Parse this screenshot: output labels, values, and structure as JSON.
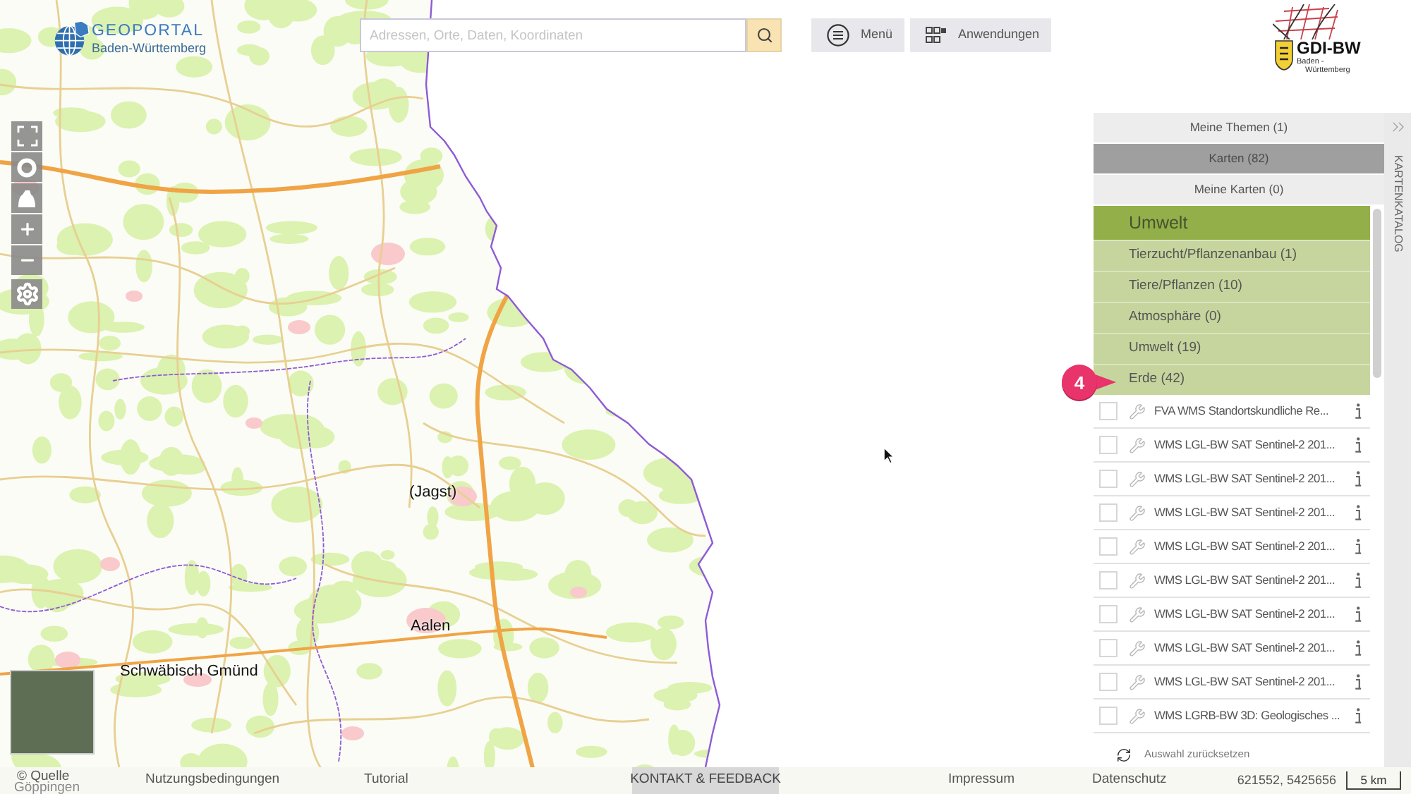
{
  "header": {
    "logo": {
      "title": "GEOPORTAL",
      "subtitle": "Baden-Württemberg"
    },
    "search": {
      "placeholder": "Adressen, Orte, Daten, Koordinaten"
    },
    "buttons": [
      {
        "kind": "menu",
        "label": "Menü"
      },
      {
        "kind": "apps",
        "label": "Anwendungen"
      }
    ],
    "partner_logo": {
      "title": "GDI-BW",
      "lines": [
        "Baden -",
        "Württemberg"
      ]
    }
  },
  "map": {
    "tools": [
      {
        "kind": "fullscreen"
      },
      {
        "kind": "locate"
      },
      {
        "kind": "home"
      },
      {
        "kind": "zoom_in"
      },
      {
        "kind": "zoom_out"
      },
      {
        "kind": "settings"
      }
    ],
    "labels": [
      "(Jagst)",
      "Aalen",
      "Schwäbisch Gmünd",
      "Göppingen"
    ]
  },
  "catalog": {
    "side_label": "KARTENKATALOG",
    "tabs": [
      {
        "label": "Meine Themen (1)",
        "selected": false
      },
      {
        "label": "Karten (82)",
        "selected": true
      },
      {
        "label": "Meine Karten (0)",
        "selected": false
      }
    ],
    "category": "Umwelt",
    "subcategories": [
      "Tierzucht/Pflanzenanbau (1)",
      "Tiere/Pflanzen (10)",
      "Atmosphäre (0)",
      "Umwelt (19)",
      "Erde (42)"
    ],
    "layers": [
      {
        "name": "FVA WMS Standortskundliche Re...",
        "checked": false
      },
      {
        "name": "WMS LGL-BW SAT Sentinel-2 201...",
        "checked": false
      },
      {
        "name": "WMS LGL-BW SAT Sentinel-2 201...",
        "checked": false
      },
      {
        "name": "WMS LGL-BW SAT Sentinel-2 201...",
        "checked": false
      },
      {
        "name": "WMS LGL-BW SAT Sentinel-2 201...",
        "checked": false
      },
      {
        "name": "WMS LGL-BW SAT Sentinel-2 201...",
        "checked": false
      },
      {
        "name": "WMS LGL-BW SAT Sentinel-2 201...",
        "checked": false
      },
      {
        "name": "WMS LGL-BW SAT Sentinel-2 201...",
        "checked": false
      },
      {
        "name": "WMS LGL-BW SAT Sentinel-2 201...",
        "checked": false
      },
      {
        "name": "WMS LGRB-BW 3D: Geologisches ...",
        "checked": false
      }
    ],
    "reset_label": "Auswahl zurücksetzen"
  },
  "callout": {
    "label": "4"
  },
  "footer": {
    "links": [
      {
        "label": "© Quelle",
        "kind": "link"
      },
      {
        "label": "Nutzungsbedingungen",
        "kind": "link"
      },
      {
        "label": "Tutorial",
        "kind": "link"
      },
      {
        "label": "KONTAKT & FEEDBACK",
        "kind": "button"
      },
      {
        "label": "Impressum",
        "kind": "link"
      },
      {
        "label": "Datenschutz",
        "kind": "link"
      }
    ],
    "coordinates": "621552, 5425656",
    "scale": "5 km"
  }
}
